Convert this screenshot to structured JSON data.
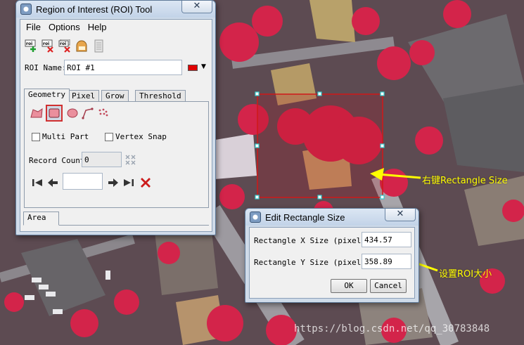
{
  "roi_window": {
    "title": "Region of Interest (ROI) Tool",
    "close_glyph": "✕",
    "menus": [
      "File",
      "Options",
      "Help"
    ],
    "toolbar_icons": [
      "roi-new-icon",
      "roi-delete-icon",
      "roi-delete-all-icon",
      "roi-load-icon",
      "roi-save-icon"
    ],
    "roi_name_label": "ROI Name:",
    "roi_name_value": "ROI #1",
    "roi_color": "#e00000",
    "tabs": [
      "Geometry",
      "Pixel",
      "Grow",
      "Threshold"
    ],
    "active_tab": "Geometry",
    "multi_part_label": "Multi Part",
    "vertex_snap_label": "Vertex Snap",
    "record_count_label": "Record Count",
    "record_count_value": "0",
    "bottom_tab": "Area"
  },
  "dialog": {
    "title": "Edit Rectangle Size",
    "close_glyph": "✕",
    "x_label": "Rectangle X Size (pixels)",
    "x_value": "434.57",
    "y_label": "Rectangle Y Size (pixels)",
    "y_value": "358.89",
    "ok_label": "OK",
    "cancel_label": "Cancel"
  },
  "annotations": {
    "right_click_text": "右键Rectangle Size",
    "set_size_text": "设置ROI大小",
    "arrow_color": "#ffff00"
  },
  "watermark": "https://blog.csdn.net/qq_30783848",
  "colors": {
    "roi_rectangle": "#d01818",
    "selection_handles": "#33cccc"
  }
}
